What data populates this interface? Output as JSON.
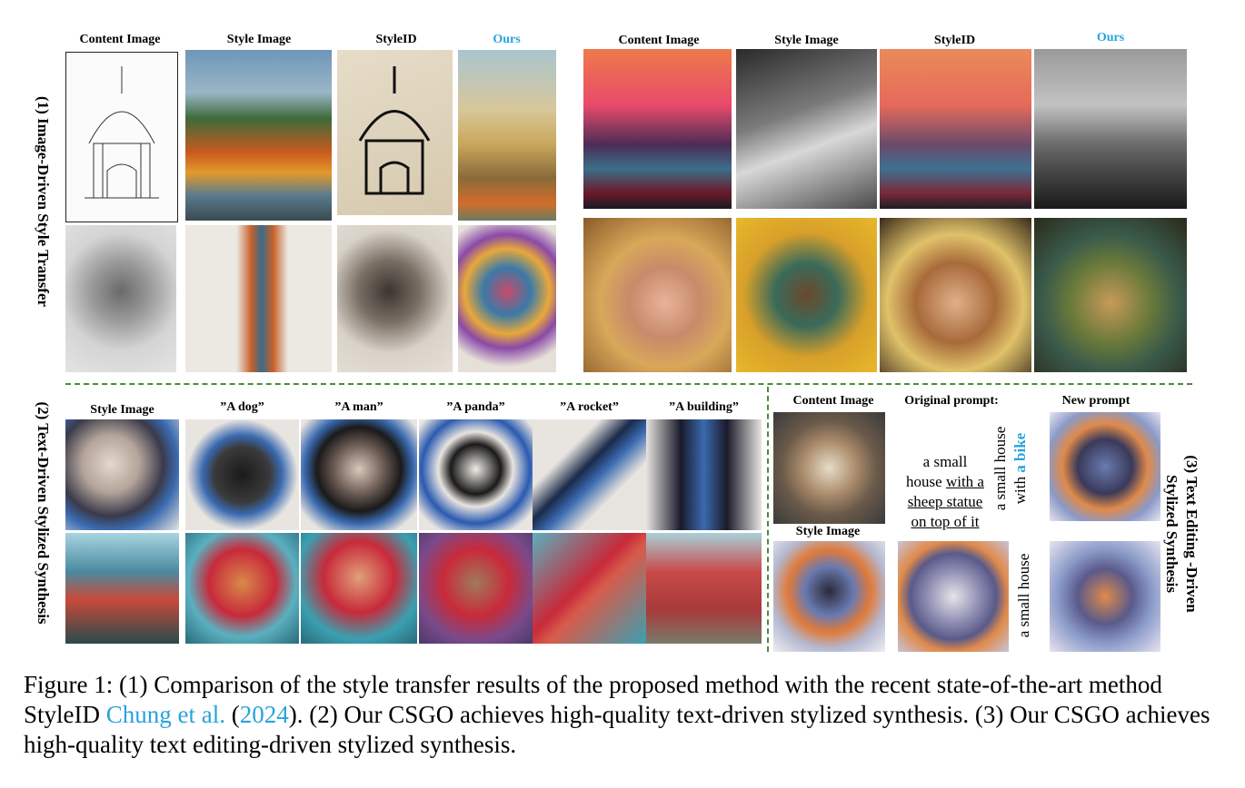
{
  "section1": {
    "label": "(1) Image-Driven Style Transfer",
    "left_headers": [
      "Content Image",
      "Style Image",
      "StyleID",
      "Ours"
    ],
    "right_headers": [
      "Content Image",
      "Style Image",
      "StyleID",
      "Ours"
    ]
  },
  "section2": {
    "label": "(2) Text-Driven Stylized Synthesis",
    "headers": [
      "Style Image",
      "”A dog”",
      "”A man”",
      "”A panda”",
      "”A rocket”",
      "”A building”"
    ]
  },
  "section3": {
    "label_line1": "(3) Text Editing -Driven",
    "label_line2": "Stylized Synthesis",
    "content_header": "Content Image",
    "style_header": "Style Image",
    "original_prompt_header": "Original prompt:",
    "new_prompt_header": "New prompt",
    "original_prompt": {
      "part1": "a small",
      "part2": "house ",
      "part3": "with a",
      "part4": "sheep statue",
      "part5": "on top of it"
    },
    "new_prompt_top": {
      "plain": "a small house",
      "plain2": "with ",
      "highlight": "a bike"
    },
    "new_prompt_bottom": "a small house"
  },
  "caption": {
    "part1": "Figure 1:   (1) Comparison of the style transfer results of the proposed method with the recent state-of-the-art method StyleID ",
    "cite_name": "Chung et al.",
    "part2": " (",
    "cite_year": "2024",
    "part3": "). (2) Our CSGO achieves high-quality text-driven stylized synthesis. (3) Our CSGO achieves high-quality text editing-driven stylized synthesis."
  }
}
